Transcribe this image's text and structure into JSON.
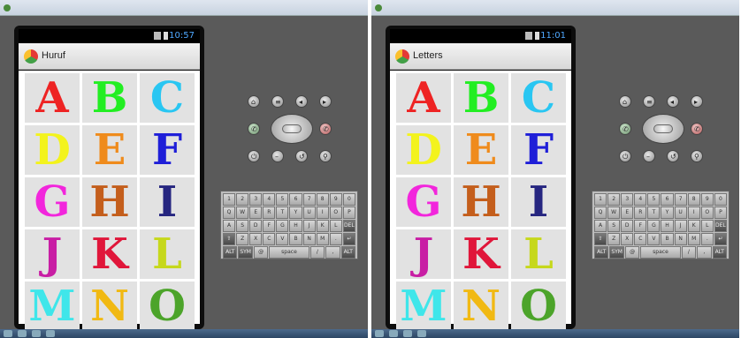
{
  "screens": [
    {
      "status": {
        "time": "10:57"
      },
      "app": {
        "title": "Huruf"
      },
      "letters": [
        {
          "char": "A",
          "color": "#ee2323"
        },
        {
          "char": "B",
          "color": "#22ee22"
        },
        {
          "char": "C",
          "color": "#29c6f2"
        },
        {
          "char": "D",
          "color": "#f3f31d"
        },
        {
          "char": "E",
          "color": "#ef8b1c"
        },
        {
          "char": "F",
          "color": "#1f1fd8"
        },
        {
          "char": "G",
          "color": "#f226dc"
        },
        {
          "char": "H",
          "color": "#c45e1c"
        },
        {
          "char": "I",
          "color": "#262680"
        },
        {
          "char": "J",
          "color": "#c81ea4"
        },
        {
          "char": "K",
          "color": "#e0163a"
        },
        {
          "char": "L",
          "color": "#c6d81c"
        },
        {
          "char": "M",
          "color": "#3fe6ea"
        },
        {
          "char": "N",
          "color": "#f1b913"
        },
        {
          "char": "O",
          "color": "#4ca42a"
        }
      ]
    },
    {
      "status": {
        "time": "11:01"
      },
      "app": {
        "title": "Letters"
      },
      "letters": [
        {
          "char": "A",
          "color": "#ee2323"
        },
        {
          "char": "B",
          "color": "#22ee22"
        },
        {
          "char": "C",
          "color": "#29c6f2"
        },
        {
          "char": "D",
          "color": "#f3f31d"
        },
        {
          "char": "E",
          "color": "#ef8b1c"
        },
        {
          "char": "F",
          "color": "#1f1fd8"
        },
        {
          "char": "G",
          "color": "#f226dc"
        },
        {
          "char": "H",
          "color": "#c45e1c"
        },
        {
          "char": "I",
          "color": "#262680"
        },
        {
          "char": "J",
          "color": "#c81ea4"
        },
        {
          "char": "K",
          "color": "#e0163a"
        },
        {
          "char": "L",
          "color": "#c6d81c"
        },
        {
          "char": "M",
          "color": "#3fe6ea"
        },
        {
          "char": "N",
          "color": "#f1b913"
        },
        {
          "char": "O",
          "color": "#4ca42a"
        }
      ]
    }
  ],
  "emulator": {
    "keyboard_rows": [
      [
        "1",
        "2",
        "3",
        "4",
        "5",
        "6",
        "7",
        "8",
        "9",
        "0"
      ],
      [
        "Q",
        "W",
        "E",
        "R",
        "T",
        "Y",
        "U",
        "I",
        "O",
        "P"
      ],
      [
        "A",
        "S",
        "D",
        "F",
        "G",
        "H",
        "J",
        "K",
        "L",
        "DEL"
      ],
      [
        "⇧",
        "Z",
        "X",
        "C",
        "V",
        "B",
        "N",
        "M",
        ".",
        "↵"
      ],
      [
        "ALT",
        "SYM",
        "@",
        "space",
        "/",
        ",",
        "ALT"
      ]
    ]
  }
}
